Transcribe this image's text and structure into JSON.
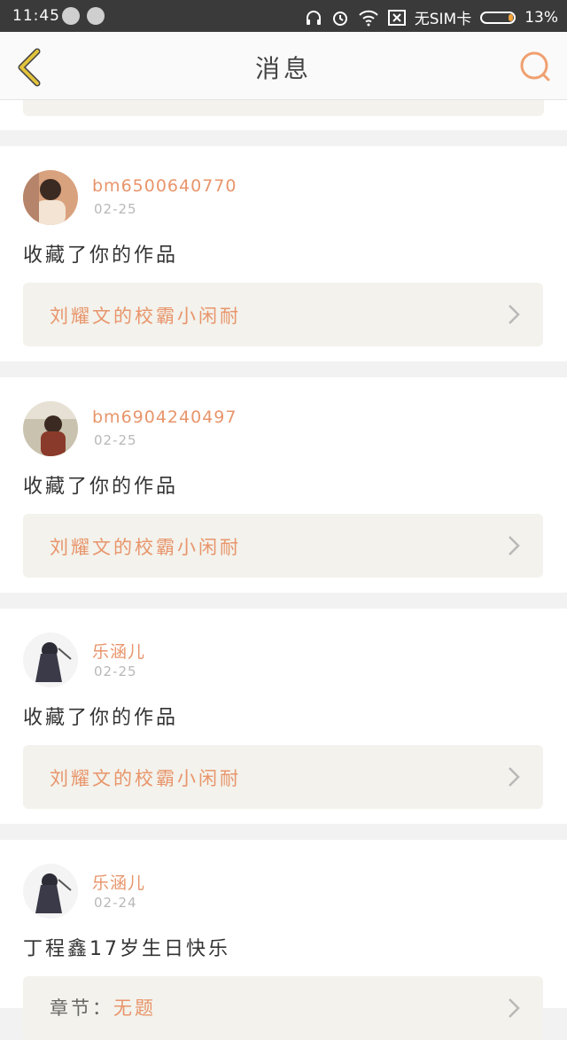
{
  "status_bar": {
    "time": "11:45",
    "sim_text": "无SIM卡",
    "battery_text": "13%",
    "battery_level": 0.13
  },
  "header": {
    "title": "消息",
    "back_icon": "chevron-left-icon",
    "search_icon": "search-icon"
  },
  "colors": {
    "accent": "#e8956b",
    "card_box": "#f3f2ec",
    "back_icon": "#e2c33b"
  },
  "messages": [
    {
      "username": "bm6500640770",
      "date": "02-25",
      "action": "收藏了你的作品",
      "work_title": "刘耀文的校霸小闲耐"
    },
    {
      "username": "bm6904240497",
      "date": "02-25",
      "action": "收藏了你的作品",
      "work_title": "刘耀文的校霸小闲耐"
    },
    {
      "username": "乐涵儿",
      "date": "02-25",
      "action": "收藏了你的作品",
      "work_title": "刘耀文的校霸小闲耐"
    },
    {
      "username": "乐涵儿",
      "date": "02-24",
      "action": "丁程鑫17岁生日快乐",
      "chapter_label": "章节：",
      "chapter_value": "无题"
    }
  ]
}
